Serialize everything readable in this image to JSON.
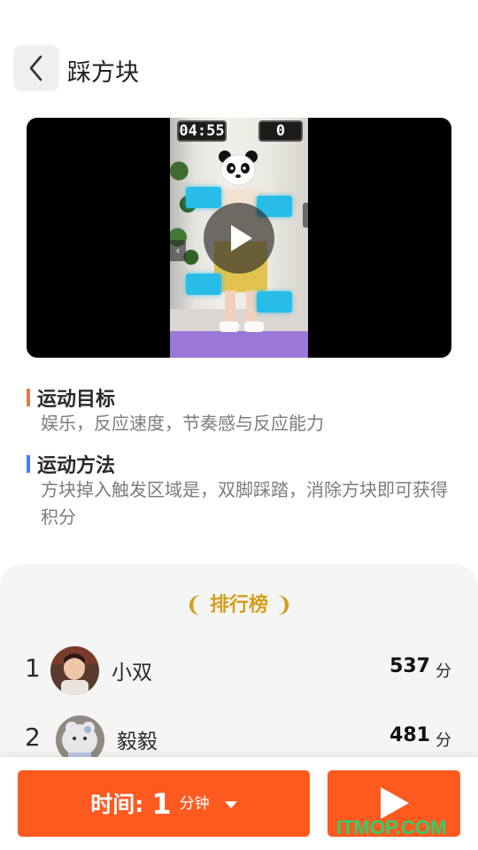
{
  "header": {
    "title": "踩方块",
    "back_icon": "chevron-left-icon"
  },
  "video": {
    "timer": "04:55",
    "score": "0",
    "play_icon": "play-icon"
  },
  "goal": {
    "title": "运动目标",
    "text": "娱乐，反应速度，节奏感与反应能力",
    "accent": "#e07a4a"
  },
  "method": {
    "title": "运动方法",
    "text": "方块掉入触发区域是，双脚踩踏，消除方块即可获得积分",
    "accent": "#4a7ef0"
  },
  "leaderboard": {
    "title": "排行榜",
    "title_color": "#d39e1c",
    "entries": [
      {
        "rank": "1",
        "name": "小双",
        "score": "537",
        "unit": "分"
      },
      {
        "rank": "2",
        "name": "毅毅",
        "score": "481",
        "unit": "分"
      }
    ]
  },
  "footer": {
    "time_label": "时间:",
    "time_value": "1",
    "time_unit": "分钟",
    "button_color": "#fe5a20"
  },
  "watermark": "ITMOP.COM"
}
